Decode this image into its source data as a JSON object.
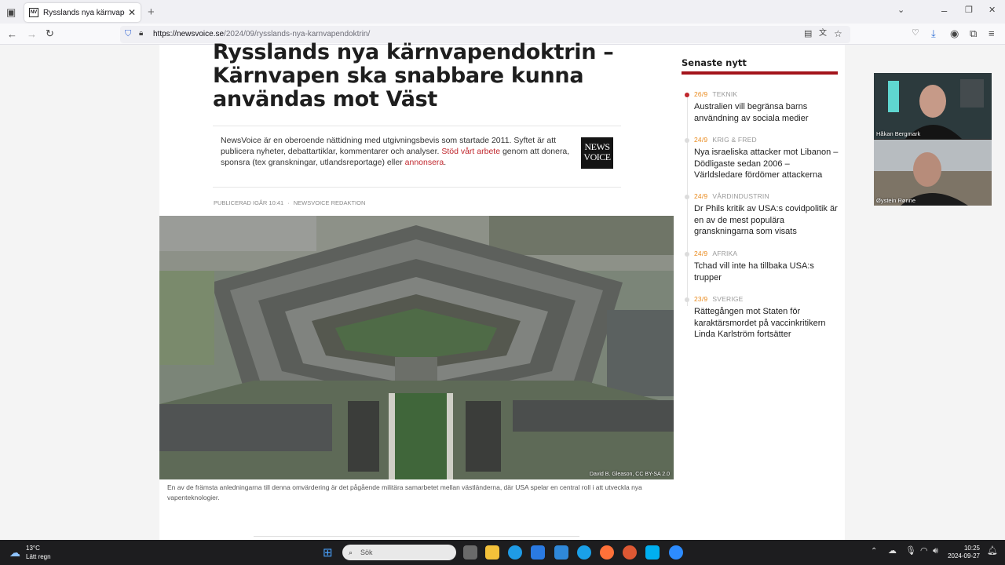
{
  "browser": {
    "tab_title": "Rysslands nya kärnvapendoktrin",
    "tab_favicon": "NV",
    "url_domain": "https://newsvoice.se",
    "url_path": "/2024/09/rysslands-nya-karnvapendoktrin/"
  },
  "article": {
    "headline": "Rysslands nya kärnvapendoktrin – Kärnvapen ska snabbare kunna användas mot Väst",
    "intro_text": "NewsVoice är en oberoende nättidning med utgivningsbevis som startade 2011. Syftet är att publicera nyheter, debattartiklar, kommentarer och analyser.",
    "intro_link1": "Stöd vårt arbete",
    "intro_text2": "genom att donera, sponsra (tex granskningar, utlandsreportage) eller",
    "intro_link2": "annonsera",
    "intro_end": ".",
    "logo_line1": "NEWS",
    "logo_line2": "VOICE",
    "published": "Publicerad igår 10:41",
    "author": "NewsVoice redaktion",
    "photo_credit": "David B. Gleason, CC BY-SA 2.0",
    "caption": "En av de främsta anledningarna till denna omvärdering är det pågående militära samarbetet mellan västländerna, där USA spelar en central roll i att utveckla nya vapenteknologier."
  },
  "sidebar": {
    "title": "Senaste nytt",
    "items": [
      {
        "date": "26/9",
        "category": "Teknik",
        "text": "Australien vill begränsa barns användning av sociala medier"
      },
      {
        "date": "24/9",
        "category": "Krig & Fred",
        "text": "Nya israeliska attacker mot Libanon – Dödligaste sedan 2006 – Världsledare fördömer attackerna"
      },
      {
        "date": "24/9",
        "category": "Vårdindustrin",
        "text": "Dr Phils kritik av USA:s covidpolitik är en av de mest populära granskningarna som visats"
      },
      {
        "date": "24/9",
        "category": "Afrika",
        "text": "Tchad vill inte ha tillbaka USA:s trupper"
      },
      {
        "date": "23/9",
        "category": "Sverige",
        "text": "Rättegången mot Staten för karaktärsmordet på vaccinkritikern Linda Karlström fortsätter"
      }
    ]
  },
  "video": {
    "participant1": "Håkan Bergmark",
    "participant2": "Øystein Rønne"
  },
  "taskbar": {
    "temperature": "13°C",
    "weather": "Lätt regn",
    "search_placeholder": "Sök",
    "time": "10:25",
    "date": "2024-09-27"
  },
  "colors": {
    "accent_red": "#c0272d",
    "bar_red": "#a3141b",
    "date_orange": "#e98a1d"
  }
}
